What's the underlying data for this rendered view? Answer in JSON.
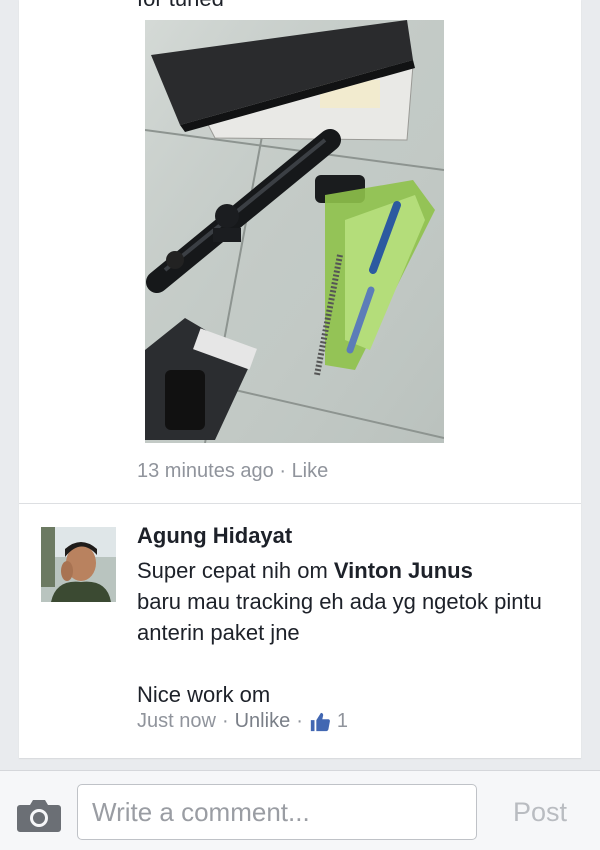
{
  "post": {
    "cut_text": "for tuned",
    "photo_alt": "Rifle scope kit with box, mounts and spring on tiled floor",
    "timestamp": "13 minutes ago",
    "separator": "·",
    "like_label": "Like"
  },
  "comment": {
    "author": "Agung Hidayat",
    "text_before_mention": "Super cepat nih om ",
    "mention": "Vinton Junus",
    "text_after_mention": "baru mau tracking eh ada yg ngetok pintu anterin paket jne",
    "text_second_paragraph": "Nice work om",
    "timestamp": "Just now",
    "unlike_label": "Unlike",
    "like_count": "1",
    "thumb_color": "#4267b2"
  },
  "composer": {
    "placeholder": "Write a comment...",
    "post_label": "Post",
    "camera_icon": "camera-icon"
  }
}
